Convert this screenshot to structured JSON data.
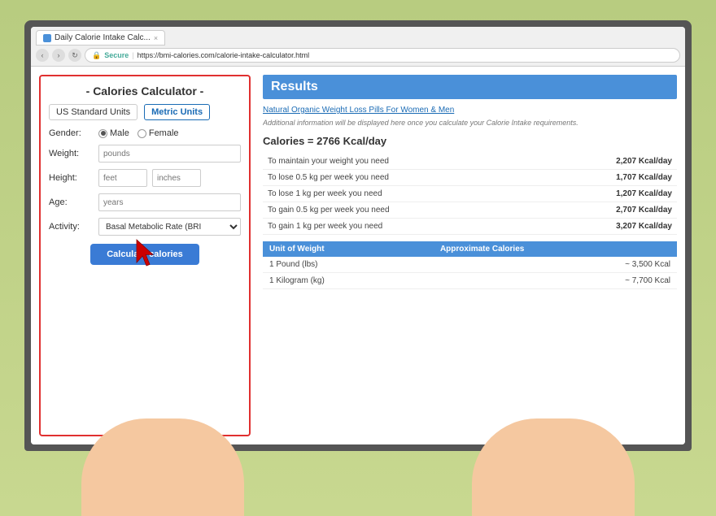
{
  "browser": {
    "tab_title": "Daily Calorie Intake Calc...",
    "tab_close": "×",
    "nav_back": "‹",
    "nav_forward": "›",
    "nav_refresh": "↻",
    "secure_label": "Secure",
    "url": "https://bmi-calories.com/calorie-intake-calculator.html"
  },
  "calculator": {
    "title": "- Calories Calculator -",
    "tab_us": "US Standard Units",
    "tab_metric": "Metric Units",
    "gender_label": "Gender:",
    "gender_male": "Male",
    "gender_female": "Female",
    "weight_label": "Weight:",
    "weight_placeholder": "pounds",
    "height_label": "Height:",
    "height_placeholder1": "feet",
    "height_placeholder2": "inches",
    "age_label": "Age:",
    "age_placeholder": "years",
    "activity_label": "Activity:",
    "activity_option": "Basal Metabolic Rate (BRI",
    "button_label": "Calculate calories"
  },
  "results": {
    "header": "Results",
    "ad_link": "Natural Organic Weight Loss Pills For Women & Men",
    "subtitle": "Additional information will be displayed here once you calculate your Calorie Intake requirements.",
    "main_value": "Calories = 2766 Kcal/day",
    "rows": [
      {
        "label": "To maintain your weight you need",
        "value": "2,207 Kcal/day"
      },
      {
        "label": "To lose 0.5 kg per week you need",
        "value": "1,707 Kcal/day"
      },
      {
        "label": "To lose 1 kg per week you need",
        "value": "1,207 Kcal/day"
      },
      {
        "label": "To gain 0.5 kg per week you need",
        "value": "2,707 Kcal/day"
      },
      {
        "label": "To gain 1 kg per week you need",
        "value": "3,207 Kcal/day"
      }
    ],
    "weight_table_header1": "Unit of Weight",
    "weight_table_header2": "Approximate Calories",
    "weight_rows": [
      {
        "unit": "1 Pound (lbs)",
        "calories": "~ 3,500 Kcal"
      },
      {
        "unit": "1 Kilogram (kg)",
        "calories": "~ 7,700 Kcal"
      }
    ]
  }
}
